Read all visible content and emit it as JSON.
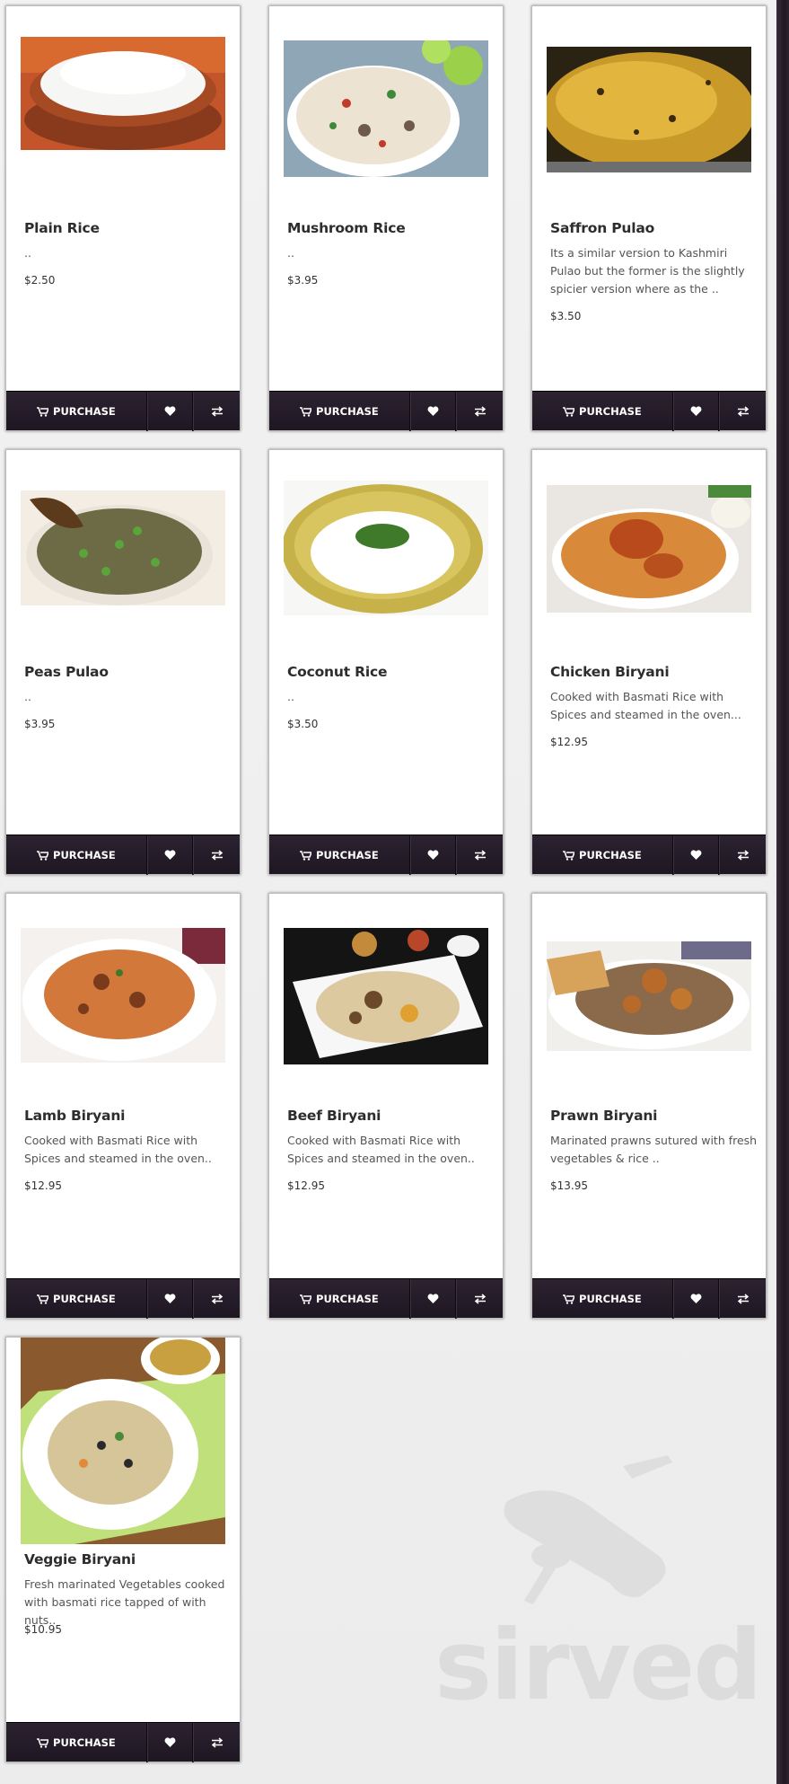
{
  "buttons": {
    "purchase": "PURCHASE"
  },
  "watermark": "sirved",
  "colors": {
    "bar": "#261d2a",
    "edge": "#2a222c"
  },
  "items": [
    {
      "name": "Plain Rice",
      "desc": "..",
      "price": "$2.50",
      "image": "plain-rice-photo"
    },
    {
      "name": "Mushroom Rice",
      "desc": "..",
      "price": "$3.95",
      "image": "mushroom-rice-photo"
    },
    {
      "name": "Saffron Pulao",
      "desc": "Its a similar version to Kashmiri Pulao but the former is the slightly spicier version where as the ..",
      "price": "$3.50",
      "image": "saffron-pulao-photo"
    },
    {
      "name": "Peas Pulao",
      "desc": "..",
      "price": "$3.95",
      "image": "peas-pulao-photo"
    },
    {
      "name": "Coconut Rice",
      "desc": "..",
      "price": "$3.50",
      "image": "coconut-rice-photo"
    },
    {
      "name": "Chicken Biryani",
      "desc": "Cooked with Basmati Rice with Spices and steamed in the oven...",
      "price": "$12.95",
      "image": "chicken-biryani-photo"
    },
    {
      "name": "Lamb Biryani",
      "desc": "Cooked with Basmati Rice with Spices and steamed in the oven..",
      "price": "$12.95",
      "image": "lamb-biryani-photo"
    },
    {
      "name": "Beef Biryani",
      "desc": "Cooked with Basmati Rice with Spices and steamed in the oven..",
      "price": "$12.95",
      "image": "beef-biryani-photo"
    },
    {
      "name": "Prawn Biryani",
      "desc": "Marinated prawns sutured with fresh vegetables & rice ..",
      "price": "$13.95",
      "image": "prawn-biryani-photo"
    },
    {
      "name": "Veggie Biryani",
      "desc": "Fresh marinated Vegetables cooked with basmati rice tapped of with nuts..",
      "price": "$10.95",
      "image": "veggie-biryani-photo"
    }
  ]
}
